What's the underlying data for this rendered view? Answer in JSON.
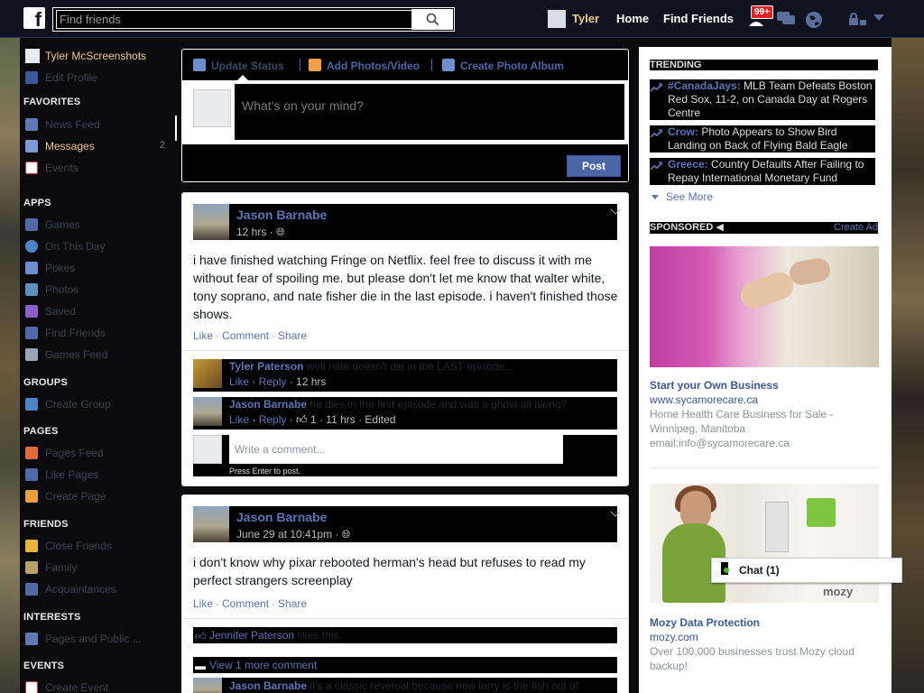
{
  "topbar": {
    "search_placeholder": "Find friends",
    "user_name": "Tyler",
    "home": "Home",
    "find_friends": "Find Friends",
    "notif_badge": "99+"
  },
  "sidebar": {
    "user": "Tyler McScreenshots",
    "edit_profile": "Edit Profile",
    "sections": {
      "favorites": "FAVORITES",
      "apps": "APPS",
      "groups": "GROUPS",
      "pages": "PAGES",
      "friends": "FRIENDS",
      "interests": "INTERESTS",
      "events": "EVENTS"
    },
    "favorites": [
      {
        "label": "News Feed",
        "count": ""
      },
      {
        "label": "Messages",
        "count": "2"
      },
      {
        "label": "Events",
        "count": ""
      }
    ],
    "apps": [
      {
        "label": "Games"
      },
      {
        "label": "On This Day"
      },
      {
        "label": "Pokes"
      },
      {
        "label": "Photos"
      },
      {
        "label": "Saved"
      },
      {
        "label": "Find Friends"
      },
      {
        "label": "Games Feed"
      }
    ],
    "groups": [
      {
        "label": "Create Group"
      }
    ],
    "pages": [
      {
        "label": "Pages Feed"
      },
      {
        "label": "Like Pages"
      },
      {
        "label": "Create Page"
      }
    ],
    "friends": [
      {
        "label": "Close Friends"
      },
      {
        "label": "Family"
      },
      {
        "label": "Acquaintances"
      }
    ],
    "interests": [
      {
        "label": "Pages and Public ..."
      }
    ],
    "events": [
      {
        "label": "Create Event"
      }
    ]
  },
  "composer": {
    "tab_status": "Update Status",
    "tab_photos": "Add Photos/Video",
    "tab_album": "Create Photo Album",
    "placeholder": "What's on your mind?",
    "post_button": "Post"
  },
  "posts": [
    {
      "author": "Jason Barnabe",
      "time": "12 hrs ·",
      "text": "i have finished watching Fringe on Netflix. feel free to discuss it with me without fear of spoiling me. but please don't let me know that walter white, tony soprano, and nate fisher die in the last episode. i haven't finished those shows.",
      "actions": {
        "like": "Like",
        "comment": "Comment",
        "share": "Share"
      },
      "comments": [
        {
          "author": "Tyler Paterson",
          "text": "well nate doesn't die in the LAST episode...",
          "like": "Like",
          "reply": "Reply",
          "meta": "· 12 hrs"
        },
        {
          "author": "Jason Barnabe",
          "text": "he dies in the first episode and was a ghost all along?",
          "like": "Like",
          "reply": "Reply",
          "likes_count": "1",
          "meta": "· 11 hrs · Edited"
        }
      ],
      "write_placeholder": "Write a comment...",
      "write_hint": "Press Enter to post."
    },
    {
      "author": "Jason Barnabe",
      "time": "June 29 at 10:41pm ·",
      "text": "i don't know why pixar rebooted herman's head but refuses to read my perfect strangers screenplay",
      "actions": {
        "like": "Like",
        "comment": "Comment",
        "share": "Share"
      },
      "likers": "Jennifer Paterson",
      "likes_suffix": "likes this.",
      "view_more": "View 1 more comment",
      "comment_preview": {
        "author": "Jason Barnabe",
        "text": "it's a classic reversal because now larry is the fish out of"
      }
    }
  ],
  "right": {
    "trending_title": "TRENDING",
    "trends": [
      {
        "tag": "#CanadaJays:",
        "text": " MLB Team Defeats Boston Red Sox, 11-2, on Canada Day at Rogers Centre"
      },
      {
        "tag": "Crow:",
        "text": " Photo Appears to Show Bird Landing on Back of Flying Bald Eagle"
      },
      {
        "tag": "Greece:",
        "text": " Country Defaults After Failing to Repay International Monetary Fund"
      }
    ],
    "see_more": "See More",
    "sponsored": "SPONSORED",
    "create_ad": "Create Ad",
    "ads": [
      {
        "title": "Start your Own Business",
        "url": "www.sycamorecare.ca",
        "body": "Home Health Care Business for Sale - Winnipeg, Manitoba email:info@sycamorecare.ca"
      },
      {
        "title": "Mozy Data Protection",
        "url": "mozy.com",
        "body": "Over 100,000 businesses trust Mozy cloud backup!",
        "brand": "mozy"
      }
    ]
  },
  "chat": {
    "label": "Chat (1)"
  },
  "colors": {
    "fb_blue": "#4a66a5",
    "link": "#5b74b8",
    "highlight": "#f2c98f",
    "badge": "#e02424",
    "online": "#42b72a"
  }
}
